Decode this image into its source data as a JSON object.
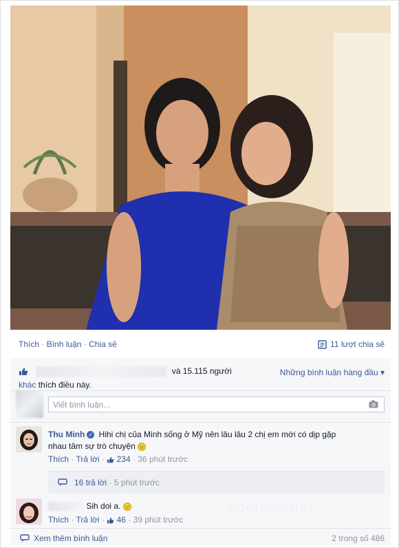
{
  "post": {
    "actions": [
      "Thích",
      "Bình luận",
      "Chia sẻ"
    ],
    "separator": "·",
    "shares_label": "11 lượt chia sẻ"
  },
  "likes": {
    "count_text": "và 15.115 người",
    "others_link": "khác",
    "tail_text": "thích điều này.",
    "top_comments": "Những bình luận hàng đầu"
  },
  "composer": {
    "placeholder": "Viết bình luận..."
  },
  "comments": [
    {
      "author": "Thu Minh",
      "text_line1": "Hihi chị của Minh sống ở Mỹ nên lâu lâu 2 chị em mới có dịp gặp",
      "text_line2": "nhau tâm sự trò chuyện",
      "like": "Thích",
      "reply": "Trả lời",
      "likes": "234",
      "time": "36 phút trước"
    },
    {
      "author": "",
      "text_line1": "Sih doi a.",
      "like": "Thích",
      "reply": "Trả lời",
      "likes": "46",
      "time": "39 phút trước"
    }
  ],
  "replies": {
    "count": "16 trả lời",
    "time": "5 phút trước"
  },
  "footer": {
    "more": "Xem thêm bình luận",
    "count": "2 trong số 486"
  },
  "colors": {
    "link": "#3b5998",
    "meta": "#90949c",
    "panel": "#f6f7f9"
  }
}
